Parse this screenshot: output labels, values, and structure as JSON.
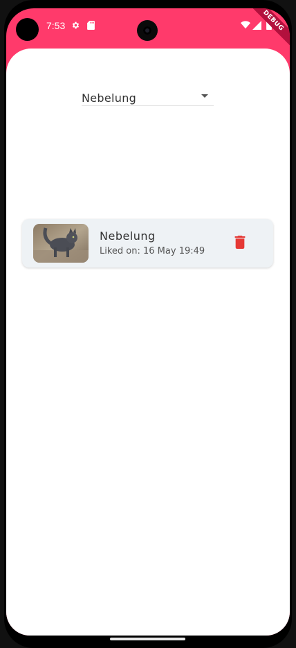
{
  "status_bar": {
    "time": "7:53",
    "icons": [
      "gear-icon",
      "sd-card-icon",
      "wifi-icon",
      "signal-icon",
      "battery-icon"
    ]
  },
  "debug_banner": "DEBUG",
  "breed_dropdown": {
    "selected": "Nebelung"
  },
  "favorites": [
    {
      "title": "Nebelung",
      "subtitle": "Liked on: 16 May 19:49",
      "image": "cat-photo-thumbnail",
      "action_icon": "trash-icon"
    }
  ],
  "colors": {
    "accent": "#ff3a6b",
    "card_bg": "#eef2f5",
    "delete": "#e53935"
  }
}
